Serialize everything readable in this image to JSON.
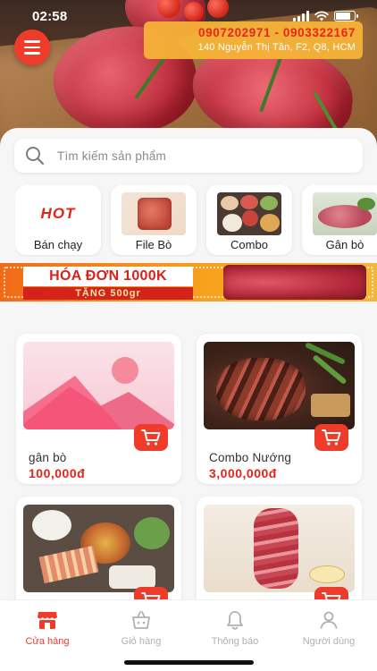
{
  "status_bar": {
    "time": "02:58"
  },
  "header": {
    "phone": "0907202971 - 0903322167",
    "address": "140 Nguyễn Thị Tần, F2, Q8, HCM"
  },
  "search": {
    "placeholder": "Tìm kiếm sản phẩm"
  },
  "categories": [
    {
      "label": "Bán chạy",
      "image_text": "HOT"
    },
    {
      "label": "File Bò"
    },
    {
      "label": "Combo"
    },
    {
      "label": "Gân bò"
    }
  ],
  "promo": {
    "title": "HÓA ĐƠN 1000K",
    "subtitle": "TẶNG 500gr"
  },
  "products": [
    {
      "name": "gân bò",
      "price": "100,000đ"
    },
    {
      "name": "Combo Nướng",
      "price": "3,000,000đ"
    },
    {
      "name": "",
      "price": ""
    },
    {
      "name": "",
      "price": ""
    }
  ],
  "tabbar": {
    "items": [
      {
        "label": "Cửa hàng",
        "active": true
      },
      {
        "label": "Giỏ hàng",
        "active": false
      },
      {
        "label": "Thông báo",
        "active": false
      },
      {
        "label": "Người dùng",
        "active": false
      }
    ]
  },
  "colors": {
    "accent": "#ef3b2a",
    "contact_bg": "#f7b538",
    "price": "#e2231a"
  }
}
